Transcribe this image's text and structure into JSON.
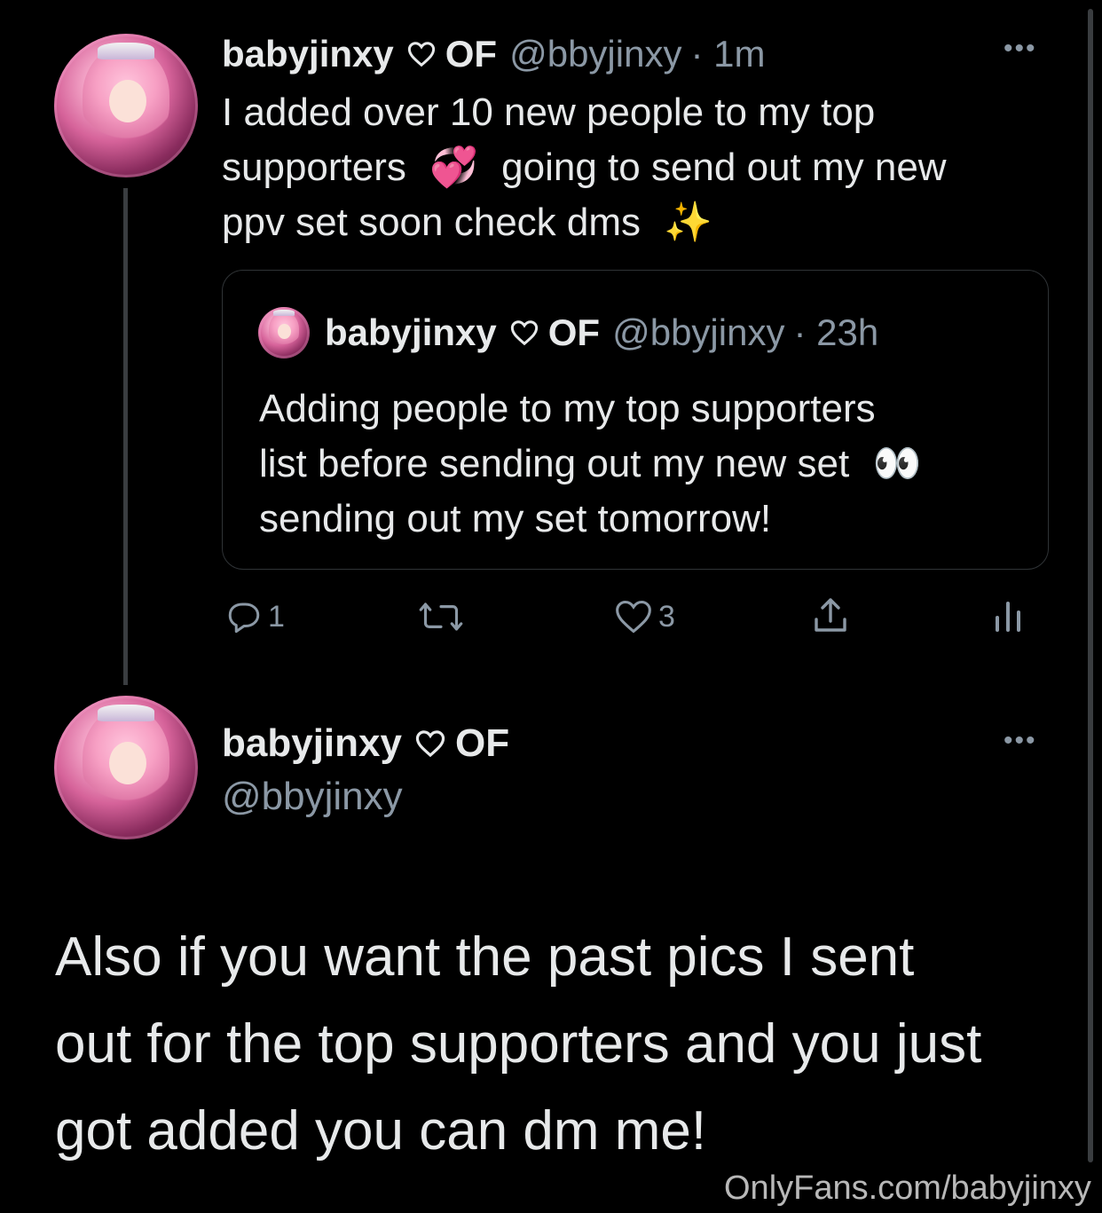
{
  "tweet1": {
    "display_name": "babyjinxy",
    "name_suffix": "OF",
    "handle": "@bbyjinxy",
    "time": "· 1m",
    "text_line1": "I added over 10 new people to my top",
    "text_line2a": "supporters",
    "text_line2b": "going to send out my new",
    "text_line3": "ppv set soon check dms",
    "emoji_heart": "💞",
    "emoji_sparkles": "✨",
    "more": "•••"
  },
  "quote": {
    "display_name": "babyjinxy",
    "name_suffix": "OF",
    "handle": "@bbyjinxy",
    "time": "· 23h",
    "text_line1": "Adding people to my top supporters",
    "text_line2": "list before sending out my new set",
    "emoji_eyes": "👀",
    "text_line3": "sending out my set tomorrow!"
  },
  "actions": {
    "reply_count": "1",
    "retweet_count": "",
    "like_count": "3"
  },
  "tweet2": {
    "display_name": "babyjinxy",
    "name_suffix": "OF",
    "handle": "@bbyjinxy",
    "more": "•••",
    "text_line1": "Also if you want the past pics I sent",
    "text_line2": "out for the top supporters and you just",
    "text_line3": "got added you can dm me!"
  },
  "watermark": "OnlyFans.com/babyjinxy",
  "colors": {
    "background": "#000000",
    "text": "#e7e9ea",
    "muted": "#8b98a5",
    "border": "#2f3336"
  }
}
